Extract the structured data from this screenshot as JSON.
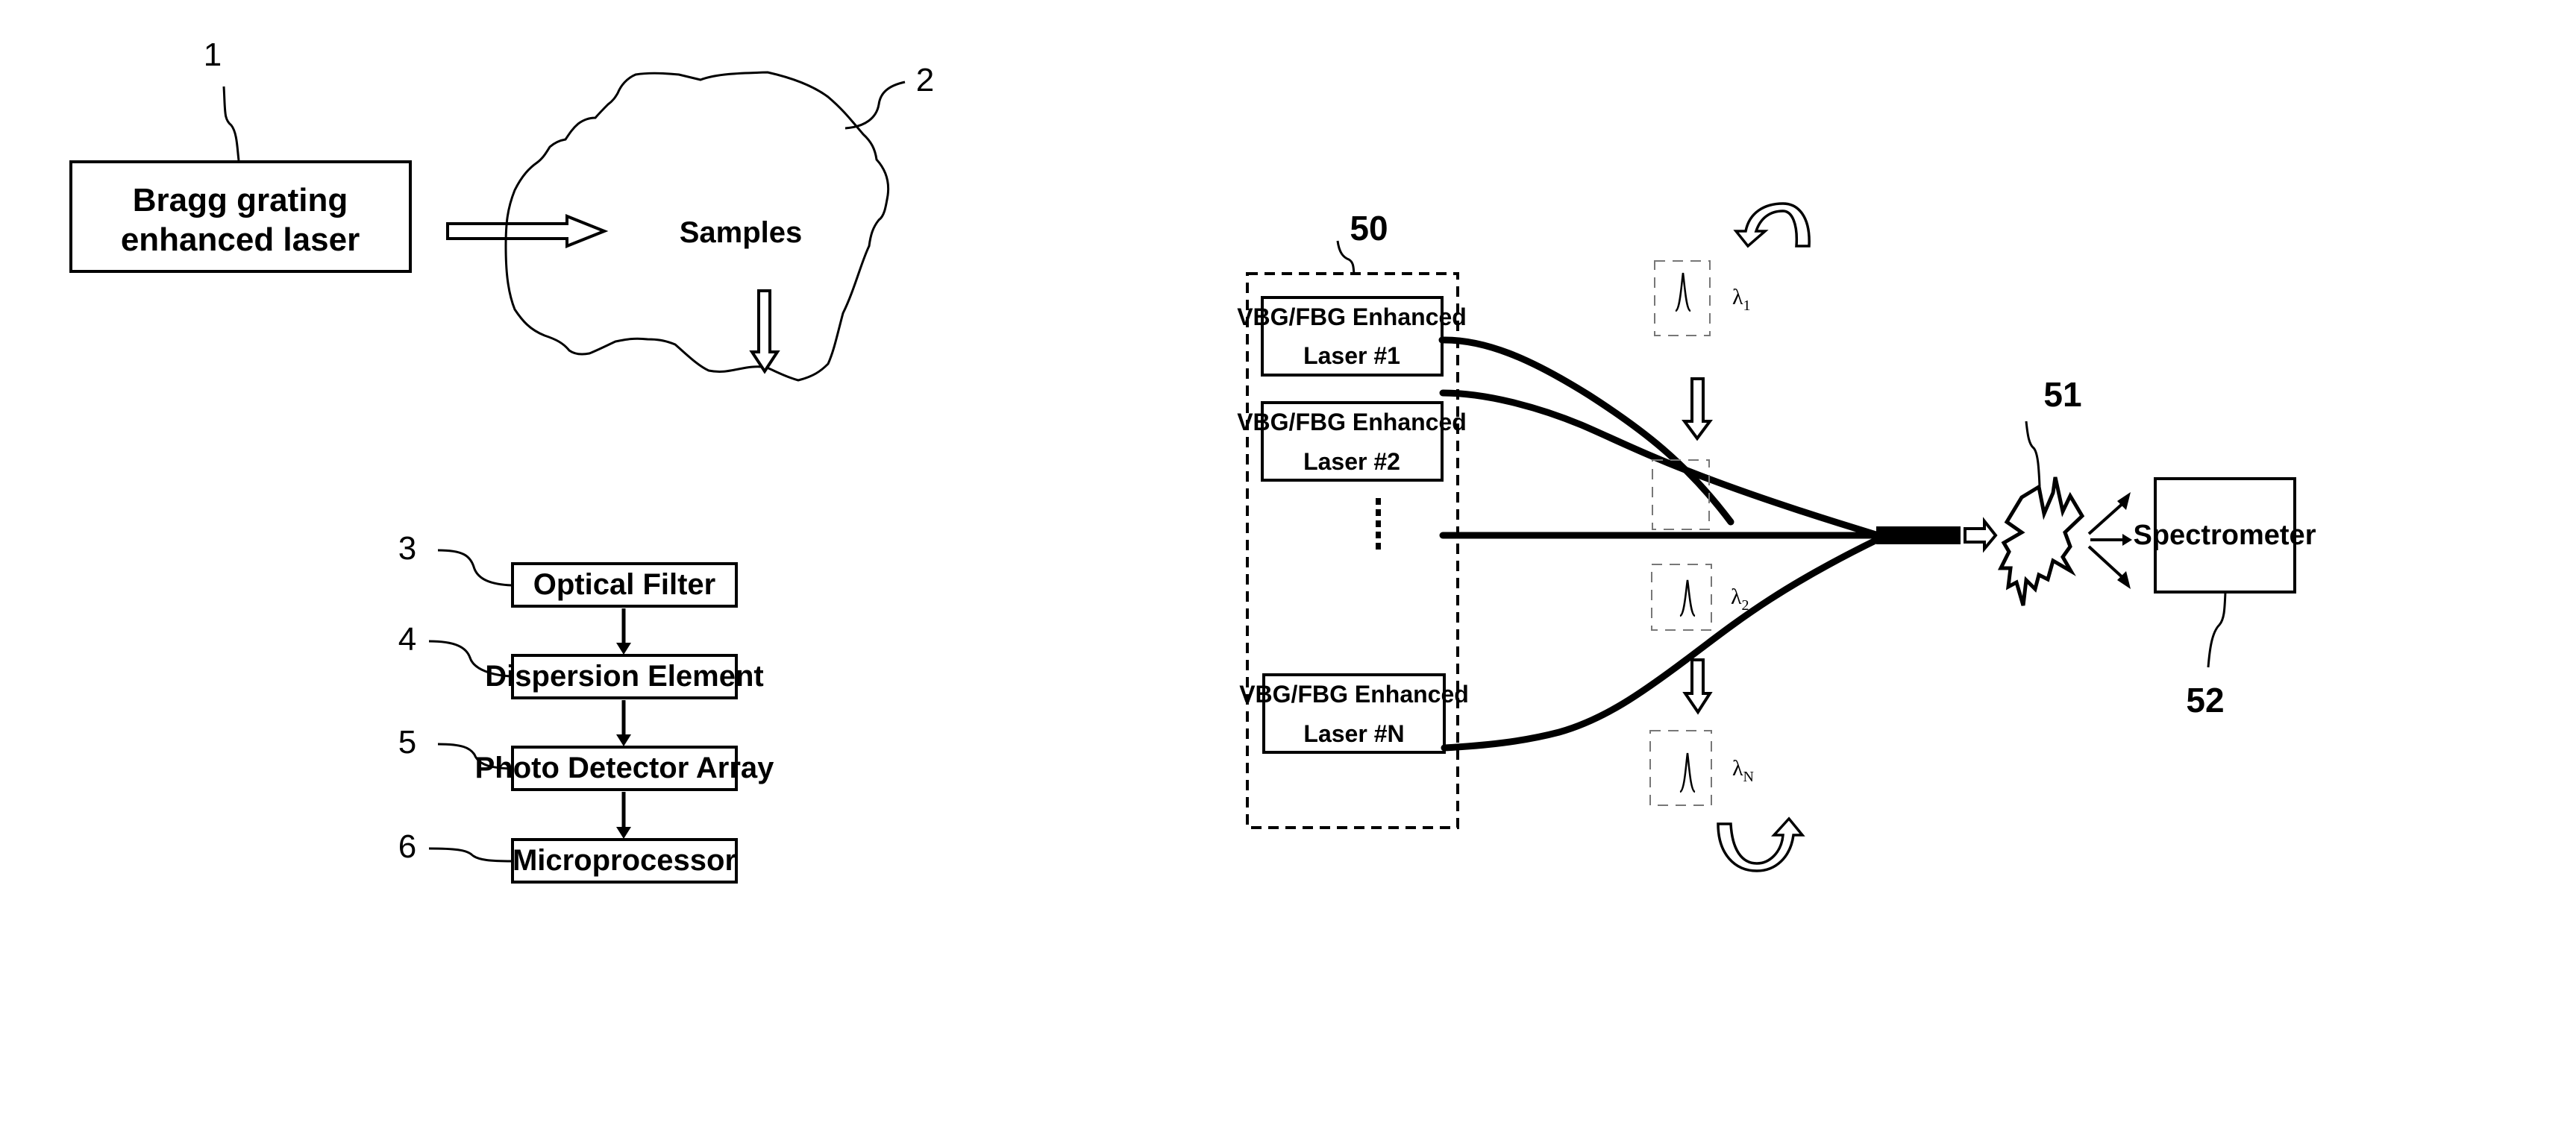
{
  "figure_left": {
    "source": {
      "ref": "1",
      "label_line1": "Bragg grating",
      "label_line2": "enhanced laser"
    },
    "samples": {
      "ref": "2",
      "label": "Samples"
    },
    "chain": [
      {
        "ref": "3",
        "label": "Optical Filter"
      },
      {
        "ref": "4",
        "label": "Dispersion Element"
      },
      {
        "ref": "5",
        "label": "Photo Detector Array"
      },
      {
        "ref": "6",
        "label": "Microprocessor"
      }
    ]
  },
  "figure_right": {
    "laser_group": {
      "ref": "50"
    },
    "lasers": [
      {
        "line1": "VBG/FBG Enhanced",
        "line2": "Laser  #1"
      },
      {
        "line1": "VBG/FBG  Enhanced",
        "line2": "Laser  #2"
      },
      {
        "line1": "VBG/FBG  Enhanced",
        "line2": "Laser  #N"
      }
    ],
    "wavelengths": [
      {
        "symbol": "λ",
        "sub": "1"
      },
      {
        "symbol": "λ",
        "sub": "2"
      },
      {
        "symbol": "λ",
        "sub": "N"
      }
    ],
    "sample": {
      "ref": "51"
    },
    "spectrometer": {
      "ref": "52",
      "label": "Spectrometer"
    }
  }
}
